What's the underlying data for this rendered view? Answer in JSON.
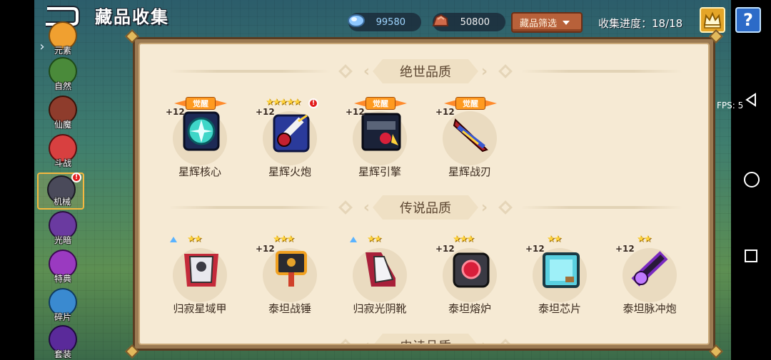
{
  "header": {
    "title": "藏品收集",
    "currency_gem": "99580",
    "currency_ore": "50800",
    "filter_label": "藏品筛选",
    "progress": "收集进度：18/18",
    "help": "?"
  },
  "sidebar": {
    "items": [
      {
        "label": "元素",
        "icon": "element-icon",
        "color": "#f0a030"
      },
      {
        "label": "自然",
        "icon": "nature-icon",
        "color": "#4a8a3a"
      },
      {
        "label": "仙魔",
        "icon": "demon-icon",
        "color": "#8e3c2c"
      },
      {
        "label": "斗战",
        "icon": "battle-icon",
        "color": "#d84040"
      },
      {
        "label": "机械",
        "icon": "mech-icon",
        "color": "#4a4a5a"
      },
      {
        "label": "光暗",
        "icon": "light-dark-icon",
        "color": "#6a3aa0"
      },
      {
        "label": "特典",
        "icon": "special-icon",
        "color": "#9a3ac0"
      },
      {
        "label": "碎片",
        "icon": "shard-icon",
        "color": "#3a8ad0"
      },
      {
        "label": "套装",
        "icon": "set-icon",
        "color": "#5a2a9a"
      }
    ],
    "active": "机械",
    "alert": "!"
  },
  "sections": [
    {
      "title": "绝世品质",
      "items": [
        {
          "name": "星辉核心",
          "level": "+12",
          "awakened": "觉醒",
          "stars": "",
          "accent": "#2aa8a0"
        },
        {
          "name": "星辉火炮",
          "level": "+12",
          "awakened": "",
          "stars": "★★★★★",
          "accent": "#2b3a8a"
        },
        {
          "name": "星辉引擎",
          "level": "+12",
          "awakened": "觉醒",
          "stars": "",
          "accent": "#222a40"
        },
        {
          "name": "星辉战刃",
          "level": "+12",
          "awakened": "觉醒",
          "stars": "",
          "accent": "#b0202a"
        }
      ]
    },
    {
      "title": "传说品质",
      "items": [
        {
          "name": "归寂星域甲",
          "level": "",
          "awakened": "",
          "stars": "★★",
          "upgrade": true,
          "accent": "#c42a3a"
        },
        {
          "name": "泰坦战锤",
          "level": "+12",
          "awakened": "",
          "stars": "★★★",
          "accent": "#e6a22a"
        },
        {
          "name": "归寂光阴靴",
          "level": "",
          "awakened": "",
          "stars": "★★",
          "upgrade": true,
          "accent": "#a8203a"
        },
        {
          "name": "泰坦熔炉",
          "level": "+12",
          "awakened": "",
          "stars": "★★★",
          "accent": "#3a3a44"
        },
        {
          "name": "泰坦芯片",
          "level": "+12",
          "awakened": "",
          "stars": "★★",
          "accent": "#5ad0e0"
        },
        {
          "name": "泰坦脉冲炮",
          "level": "+12",
          "awakened": "",
          "stars": "★★",
          "accent": "#7a2ac0"
        }
      ]
    },
    {
      "title": "史诗品质",
      "items": []
    }
  ],
  "system": {
    "fps": "FPS: 5"
  }
}
